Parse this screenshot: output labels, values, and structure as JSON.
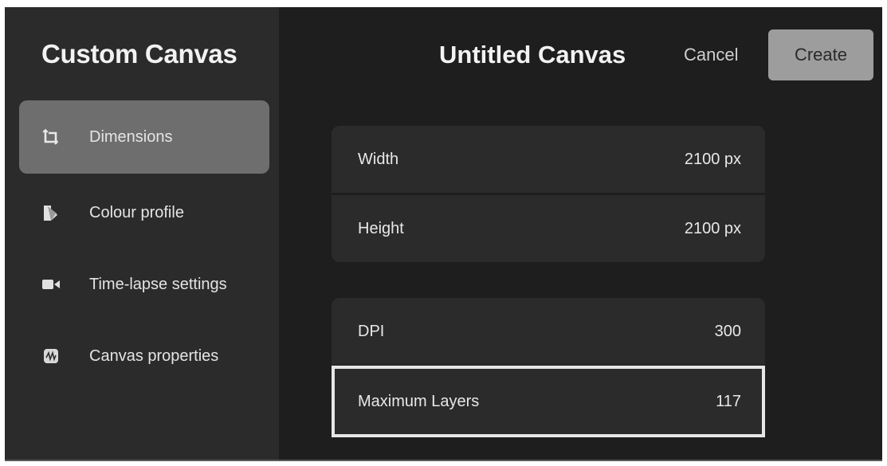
{
  "sidebar": {
    "title": "Custom Canvas",
    "items": [
      {
        "label": "Dimensions",
        "icon": "crop-corners-icon",
        "active": true
      },
      {
        "label": "Colour profile",
        "icon": "color-swatch-icon",
        "active": false
      },
      {
        "label": "Time-lapse settings",
        "icon": "video-camera-icon",
        "active": false
      },
      {
        "label": "Canvas properties",
        "icon": "waveform-card-icon",
        "active": false
      }
    ]
  },
  "header": {
    "title": "Untitled Canvas",
    "cancel_label": "Cancel",
    "create_label": "Create"
  },
  "fields": [
    {
      "label": "Width",
      "value": "2100 px"
    },
    {
      "label": "Height",
      "value": "2100 px"
    },
    {
      "label": "DPI",
      "value": "300"
    },
    {
      "label": "Maximum Layers",
      "value": "117"
    }
  ],
  "colors": {
    "background": "#1e1e1e",
    "sidebar": "#2b2b2b",
    "active_item": "#6e6e6e",
    "create_button": "#9d9d9d",
    "highlight_border": "#e6e6e6"
  }
}
